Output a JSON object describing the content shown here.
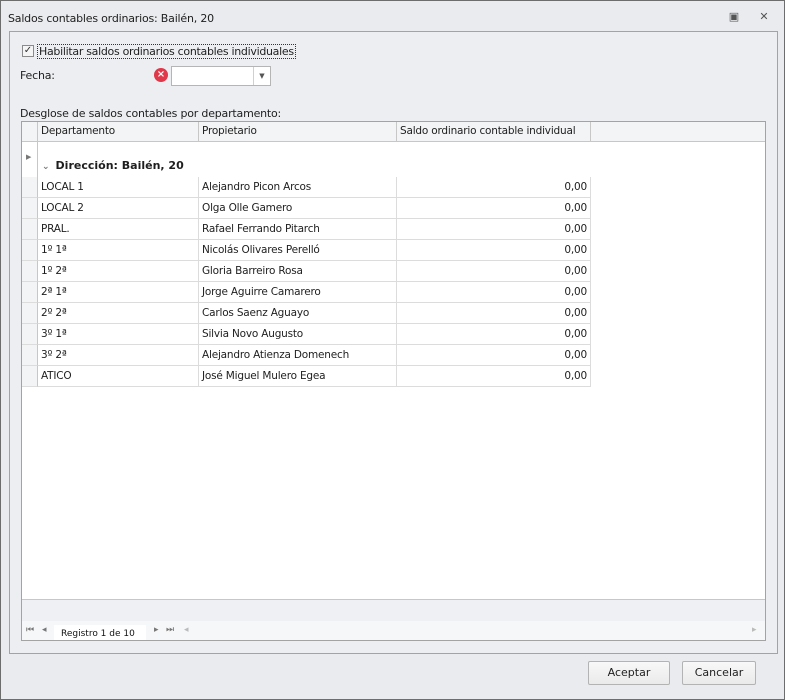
{
  "window": {
    "title": "Saldos contables ordinarios: Bailén, 20"
  },
  "form": {
    "enable_label": "Habilitar saldos ordinarios contables individuales",
    "enable_checked": true,
    "date_label": "Fecha:",
    "date_value": "",
    "breakdown_label": "Desglose de saldos contables por departamento:"
  },
  "grid": {
    "columns": [
      "Departamento",
      "Propietario",
      "Saldo ordinario contable individual"
    ],
    "group": "Dirección: Bailén, 20",
    "rows": [
      {
        "dept": "LOCAL 1",
        "owner": "Alejandro Picon Arcos",
        "balance": "0,00"
      },
      {
        "dept": "LOCAL 2",
        "owner": "Olga Olle Gamero",
        "balance": "0,00"
      },
      {
        "dept": "PRAL.",
        "owner": "Rafael Ferrando Pitarch",
        "balance": "0,00"
      },
      {
        "dept": "1º 1ª",
        "owner": "Nicolás Olivares Perelló",
        "balance": "0,00"
      },
      {
        "dept": "1º 2ª",
        "owner": "Gloria Barreiro Rosa",
        "balance": "0,00"
      },
      {
        "dept": "2ª 1ª",
        "owner": "Jorge Aguirre Camarero",
        "balance": "0,00"
      },
      {
        "dept": "2º 2ª",
        "owner": "Carlos Saenz Aguayo",
        "balance": "0,00"
      },
      {
        "dept": "3º 1ª",
        "owner": "Silvia Novo Augusto",
        "balance": "0,00"
      },
      {
        "dept": "3º 2ª",
        "owner": "Alejandro Atienza Domenech",
        "balance": "0,00"
      },
      {
        "dept": "ATICO",
        "owner": "José Miguel Mulero Egea",
        "balance": "0,00"
      }
    ],
    "record_text": "Registro 1 de 10"
  },
  "buttons": {
    "accept": "Aceptar",
    "cancel": "Cancelar"
  }
}
